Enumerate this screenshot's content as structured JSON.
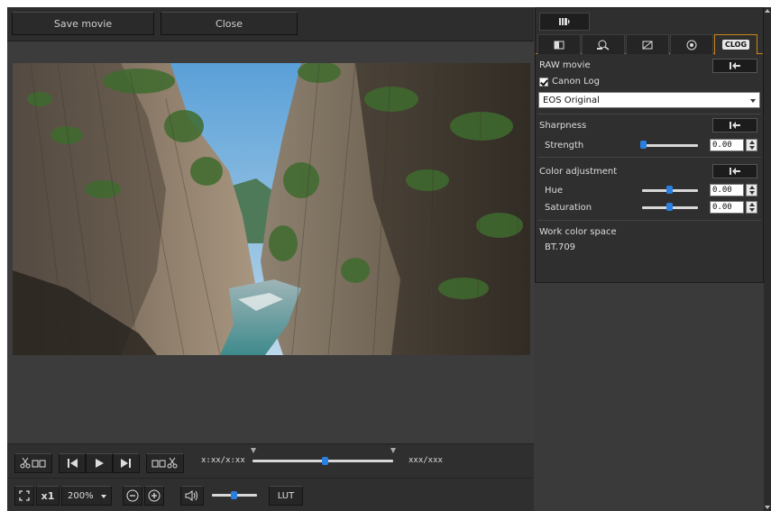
{
  "toolbar": {
    "save_label": "Save movie",
    "close_label": "Close"
  },
  "transport": {
    "timecode": "x:xx/x:xx",
    "frames": "xxx/xxx"
  },
  "bottombar": {
    "speed": "x1",
    "zoom": "200%",
    "lut": "LUT"
  },
  "panel": {
    "tabs": [
      "view-icon",
      "zoom-icon",
      "curve-icon",
      "color-wheel-icon",
      "CLOG"
    ],
    "raw_movie_label": "RAW movie",
    "canon_log_label": "Canon Log",
    "canon_log_checked": true,
    "preset_value": "EOS Original",
    "sharpness_label": "Sharpness",
    "strength_label": "Strength",
    "strength_value": "0.00",
    "color_adjustment_label": "Color adjustment",
    "hue_label": "Hue",
    "hue_value": "0.00",
    "saturation_label": "Saturation",
    "saturation_value": "0.00",
    "work_color_space_label": "Work color space",
    "work_color_space_value": "BT.709"
  },
  "colors": {
    "accent": "#c8861a",
    "knob": "#2a7fe0"
  }
}
